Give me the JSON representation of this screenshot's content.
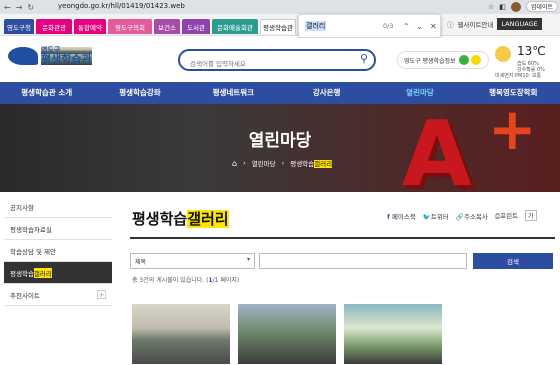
{
  "browser": {
    "url": "yeongdo.go.kr/hll/01419/01423.web",
    "update_label": "업데이트"
  },
  "site_tabs": [
    {
      "label": "영도구청",
      "color": "#2d4ea0"
    },
    {
      "label": "문화관광",
      "color": "#e4007f"
    },
    {
      "label": "통합예약",
      "color": "#e4007f"
    },
    {
      "label": "영도구의회",
      "color": "#e25b9c"
    },
    {
      "label": "보건소",
      "color": "#a64ca6"
    },
    {
      "label": "도서관",
      "color": "#8e44ad"
    },
    {
      "label": "문화예술회관",
      "color": "#2a9d8f"
    },
    {
      "label": "평생학습관",
      "color": "#f3f3f3"
    }
  ],
  "find_bar": {
    "query": "갤러리",
    "count": "0/3"
  },
  "top_links": {
    "sitemap": "웹사이트안내",
    "language": "LANGUAGE"
  },
  "header": {
    "logo_small": "영도구",
    "logo_big": "평생학습관",
    "search_placeholder": "검색어를 입력하세요",
    "info_label": "영도구 평생학습정보",
    "weather_temp": "13℃",
    "weather_line1": "습도 60%",
    "weather_line2": "강수확률 0%",
    "weather_line3": "미세먼지 PM10: 보통"
  },
  "nav": [
    "평생학습관 소개",
    "평생학습강좌",
    "평생네트워크",
    "강사은행",
    "열린마당",
    "행복영도장학회"
  ],
  "hero": {
    "title": "열린마당",
    "crumb1": "열린마당",
    "crumb2_prefix": "평생학습",
    "crumb2_highlight": "갤러리"
  },
  "sidebar": [
    {
      "label": "공지사항"
    },
    {
      "label": "평생학습자료실"
    },
    {
      "label": "학습상담 및 제안"
    },
    {
      "label_prefix": "평생학습",
      "label_highlight": "갤러리"
    },
    {
      "label": "추천사이트"
    }
  ],
  "page": {
    "title_prefix": "평생학습",
    "title_highlight": "갤러리",
    "share_facebook": "페이스북",
    "share_twitter": "트위터",
    "share_copy": "주소복사",
    "share_print": "프린트",
    "font_size_label": "가",
    "filter_select": "제목",
    "search_button": "검색",
    "count_text": "총 3건의 게시물이 있습니다. (",
    "count_page": "1",
    "count_total": "/1 페이지)"
  },
  "colors": {
    "primary": "#2d4ea0",
    "highlight": "#ffe600",
    "accent_red": "#c8171d"
  },
  "icons": [
    "back-icon",
    "forward-icon",
    "reload-icon",
    "home-icon",
    "search-icon",
    "chevron-up-icon",
    "chevron-down-icon",
    "close-icon",
    "sun-icon",
    "plus-icon",
    "print-icon"
  ]
}
